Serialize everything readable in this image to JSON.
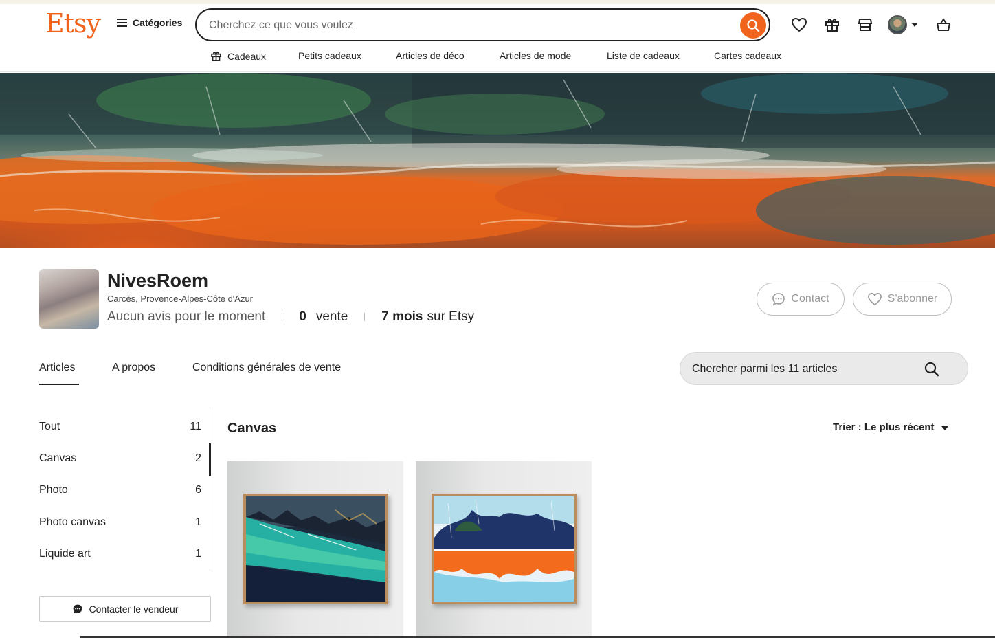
{
  "brand": {
    "logo": "Etsy",
    "accent": "#f1641e"
  },
  "header": {
    "categories_label": "Catégories",
    "search_placeholder": "Cherchez ce que vous voulez",
    "icons": [
      "heart-icon",
      "gift-icon",
      "shop-icon",
      "avatar",
      "cart-icon"
    ]
  },
  "subnav": {
    "items": [
      "Cadeaux",
      "Petits cadeaux",
      "Articles de déco",
      "Articles de mode",
      "Liste de cadeaux",
      "Cartes cadeaux"
    ]
  },
  "shop": {
    "name": "NivesRoem",
    "location": "Carcès, Provence-Alpes-Côte d'Azur",
    "reviews": "Aucun avis pour le moment",
    "sales_count": "0",
    "sales_label": "vente",
    "age_value": "7 mois",
    "age_suffix": "sur Etsy",
    "contact_label": "Contact",
    "follow_label": "S'abonner"
  },
  "tabs": [
    "Articles",
    "A propos",
    "Conditions générales de vente"
  ],
  "shop_search_placeholder": "Chercher parmi les 11 articles",
  "sidebar": {
    "items": [
      {
        "label": "Tout",
        "count": "11"
      },
      {
        "label": "Canvas",
        "count": "2"
      },
      {
        "label": "Photo",
        "count": "6"
      },
      {
        "label": "Photo canvas",
        "count": "1"
      },
      {
        "label": "Liquide art",
        "count": "1"
      }
    ],
    "active_index": 1,
    "contact_seller_label": "Contacter le vendeur"
  },
  "listing": {
    "section_title": "Canvas",
    "sort_label": "Trier : Le plus récent"
  }
}
